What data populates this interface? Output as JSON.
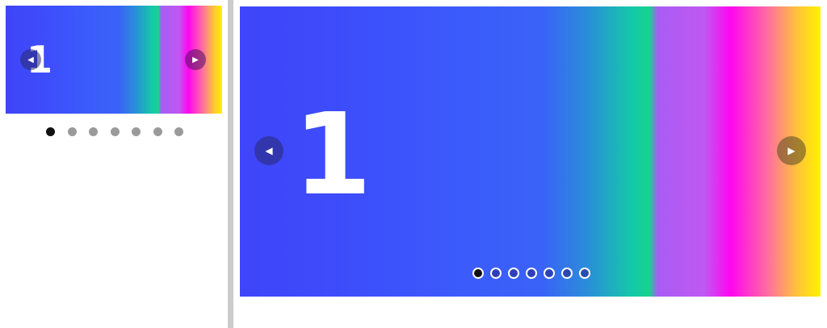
{
  "thumbnail_carousel": {
    "slide_number": "1",
    "prev_icon": "◀",
    "next_icon": "▶",
    "dots": [
      {
        "active": true
      },
      {
        "active": false
      },
      {
        "active": false
      },
      {
        "active": false
      },
      {
        "active": false
      },
      {
        "active": false
      },
      {
        "active": false
      }
    ]
  },
  "main_carousel": {
    "slide_number": "1",
    "prev_icon": "◀",
    "next_icon": "▶",
    "dots": [
      {
        "active": true
      },
      {
        "active": false
      },
      {
        "active": false
      },
      {
        "active": false
      },
      {
        "active": false
      },
      {
        "active": false
      },
      {
        "active": false
      }
    ]
  },
  "colors": {
    "gradient": [
      "#3f45fa",
      "#3b5bfb",
      "#14c9a9",
      "#a95cf4",
      "#ff05f0",
      "#fff200"
    ],
    "divider": "#cbcbcb",
    "dot_active": "#111111",
    "dot_inactive": "#9a9a9a"
  }
}
